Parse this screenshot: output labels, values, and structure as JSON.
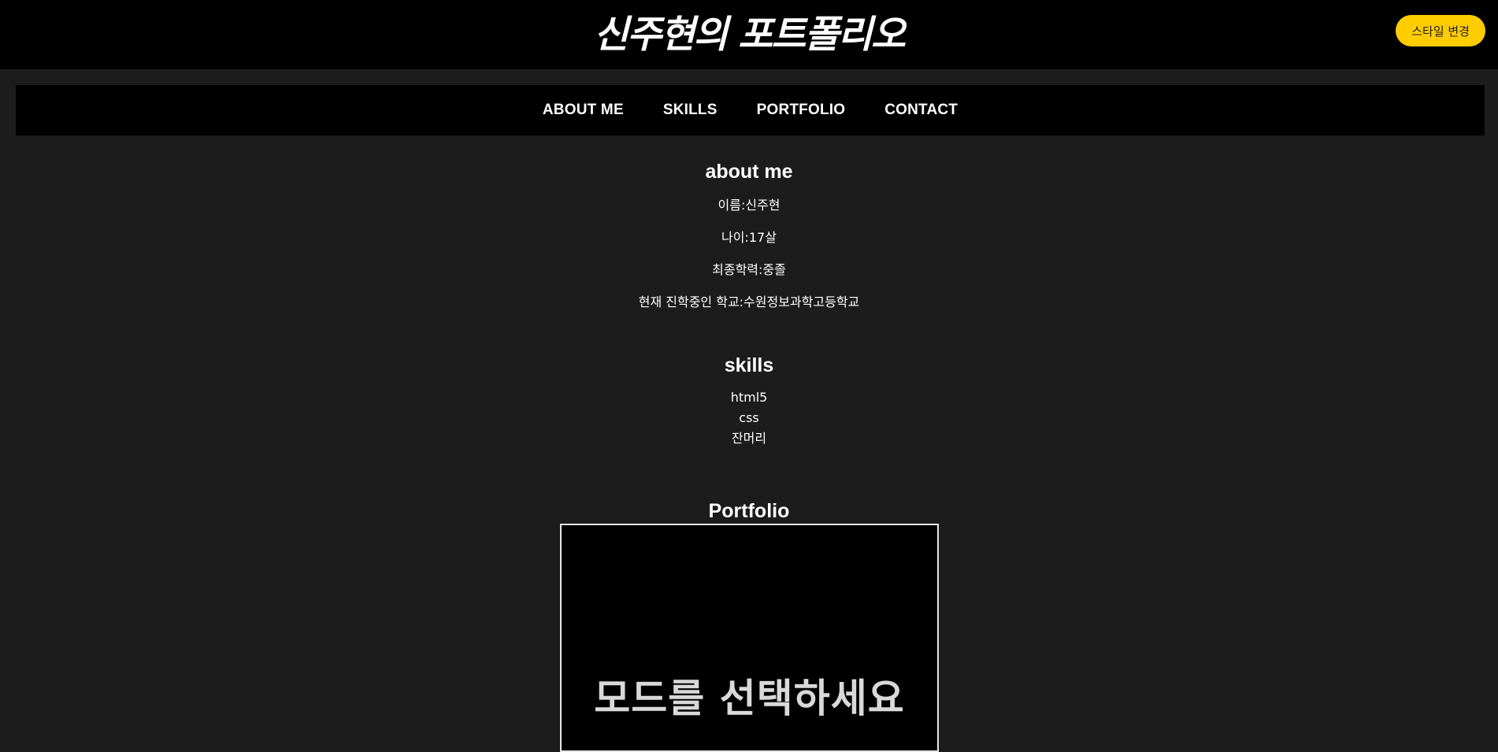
{
  "header": {
    "title": "신주현의 포트폴리오",
    "style_button": "스타일 변경"
  },
  "nav": {
    "items": [
      "ABOUT ME",
      "SKILLS",
      "PORTFOLIO",
      "CONTACT"
    ]
  },
  "about": {
    "heading": "about me",
    "lines": [
      "이름:신주현",
      "나이:17살",
      "최종학력:중졸",
      "현재 진학중인 학교:수원정보과학고등학교"
    ]
  },
  "skills": {
    "heading": "skills",
    "items": [
      "html5",
      "css",
      "잔머리"
    ]
  },
  "portfolio": {
    "heading": "Portfolio",
    "mode_prompt": "모드를 선택하세요"
  },
  "colors": {
    "background": "#1c1c1c",
    "bar": "#000000",
    "accent": "#ffcc00"
  }
}
